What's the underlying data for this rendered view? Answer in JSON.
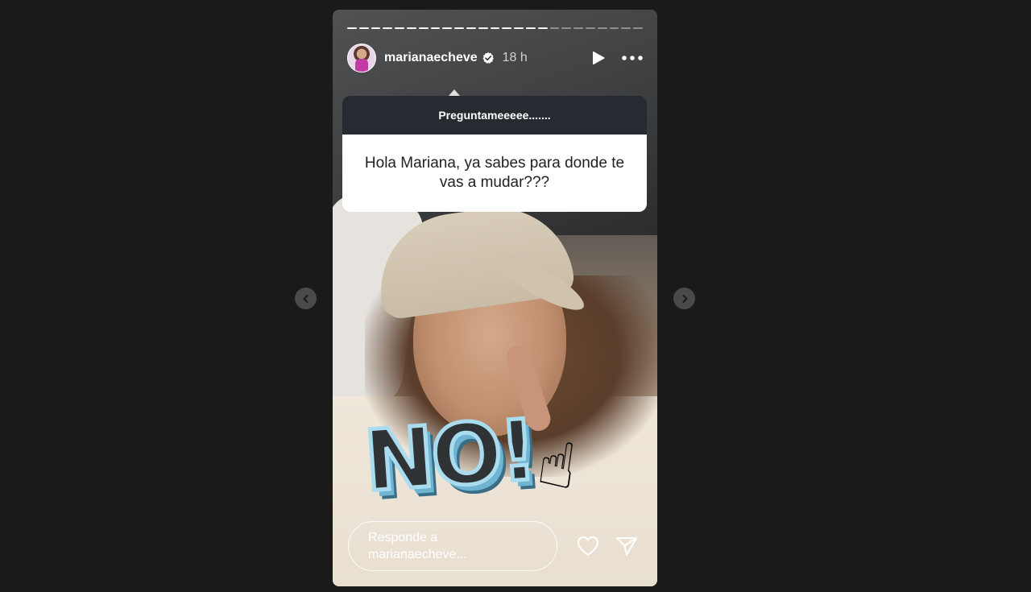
{
  "story": {
    "progress": {
      "segments_total": 25,
      "segments_done": 17
    },
    "header": {
      "username": "marianaecheve",
      "time": "18 h",
      "verified_icon": "verified-badge-icon",
      "play_icon": "play-icon",
      "more_icon": "more-horizontal-icon"
    },
    "question": {
      "prompt": "Preguntameeeee.......",
      "text": "Hola Mariana, ya sabes para donde te vas a mudar???"
    },
    "sticker": {
      "text": "NO!",
      "emoji": "☝"
    },
    "reply": {
      "placeholder": "Responde a marianaecheve...",
      "like_icon": "heart-icon",
      "share_icon": "send-icon"
    }
  },
  "navigation": {
    "prev_icon": "chevron-left-icon",
    "next_icon": "chevron-right-icon"
  },
  "colors": {
    "page_background": "#1a1a1a",
    "question_header": "#262a31",
    "sticker_stroke": "#a8dcee"
  }
}
